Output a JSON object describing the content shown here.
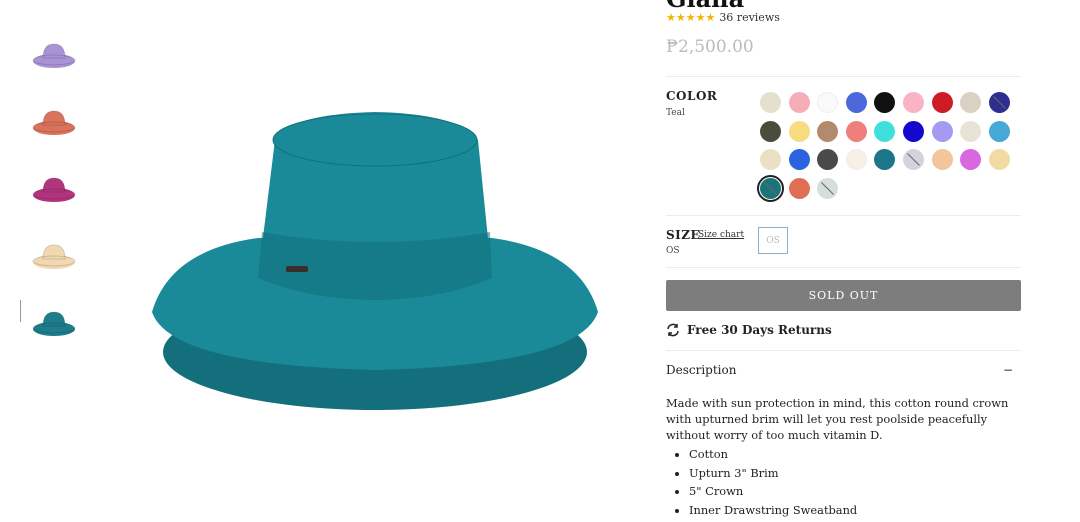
{
  "product": {
    "title": "Giana",
    "rating_stars": "★★★★★",
    "reviews": "36 reviews",
    "price": "₱2,500.00"
  },
  "thumbnails": [
    {
      "name": "thumb-lavender",
      "color": "#a893d4"
    },
    {
      "name": "thumb-coral",
      "color": "#d9735c"
    },
    {
      "name": "thumb-magenta",
      "color": "#b2347e"
    },
    {
      "name": "thumb-cream",
      "color": "#f1d8b0"
    },
    {
      "name": "thumb-teal",
      "color": "#1d7d8b",
      "active": true
    }
  ],
  "main_image": {
    "color": "#1a8a99",
    "shade": "#146f7c"
  },
  "color_option": {
    "label": "COLOR",
    "selected": "Teal",
    "swatches": [
      {
        "color": "#e4e0cc"
      },
      {
        "color": "#f7adb8"
      },
      {
        "color": "#fafafa"
      },
      {
        "color": "#4b69dd"
      },
      {
        "color": "#111111"
      },
      {
        "color": "#f8b3c5"
      },
      {
        "color": "#cf1b26"
      },
      {
        "color": "#d9d2c4"
      },
      {
        "color": "#2e2e8e",
        "unavailable": true
      },
      {
        "color": "#4a4d3c"
      },
      {
        "color": "#f8dc80"
      },
      {
        "color": "#b28a6c"
      },
      {
        "color": "#ef7f7a"
      },
      {
        "color": "#3fe0dc"
      },
      {
        "color": "#1408cf"
      },
      {
        "color": "#a59af3"
      },
      {
        "color": "#e7e3d7"
      },
      {
        "color": "#47a7d6"
      },
      {
        "color": "#ece0c4"
      },
      {
        "color": "#2a62e2"
      },
      {
        "color": "#4a4a4a"
      },
      {
        "color": "#f8efe7"
      },
      {
        "color": "#1b768c"
      },
      {
        "color": "#d3d3dc",
        "unavailable": true
      },
      {
        "color": "#f2c59a"
      },
      {
        "color": "#d768dd"
      },
      {
        "color": "#f1dba3"
      },
      {
        "color": "#1b7478",
        "selected": true,
        "unavailable": true
      },
      {
        "color": "#df6e55"
      },
      {
        "color": "#d3dedd",
        "unavailable": true
      }
    ]
  },
  "size_option": {
    "label": "SIZE",
    "chart_link": "Size chart",
    "selected": "OS",
    "button": "OS"
  },
  "actions": {
    "sold_out": "SOLD OUT",
    "returns": "Free 30 Days Returns"
  },
  "description": {
    "heading": "Description",
    "toggle": "−",
    "text": "Made with sun protection in mind, this cotton round crown with upturned brim will let you rest poolside peacefully without worry of too much vitamin D.",
    "bullets": [
      "Cotton",
      "Upturn 3\" Brim",
      "5\" Crown",
      "Inner Drawstring Sweatband"
    ]
  }
}
